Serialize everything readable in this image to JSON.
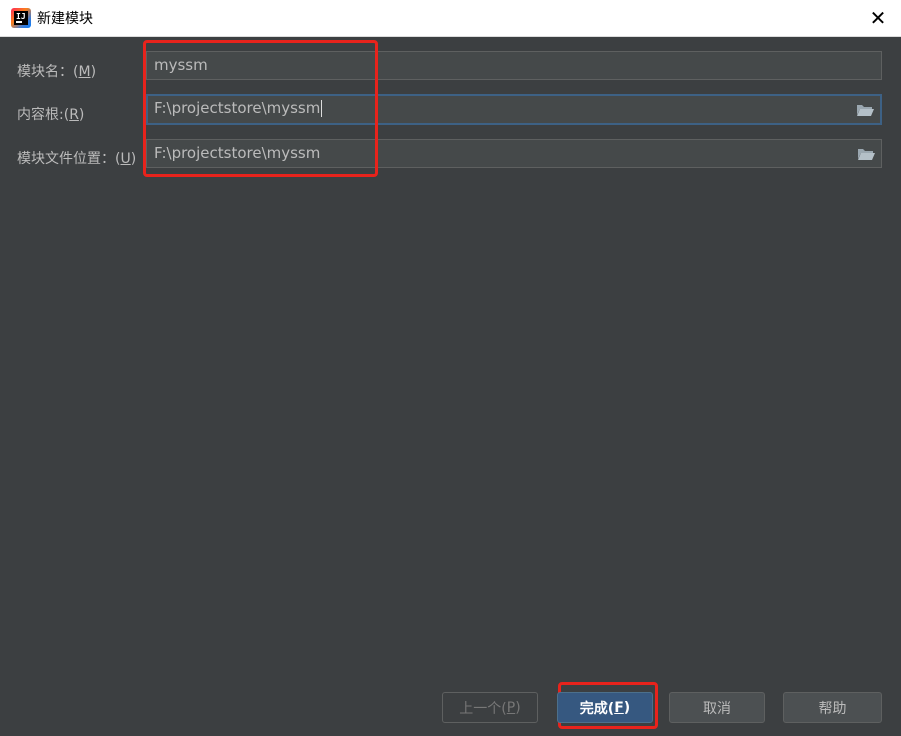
{
  "window": {
    "title": "新建模块",
    "close_glyph": "✕"
  },
  "form": {
    "module_name": {
      "label_prefix": "模块名：(",
      "mnemonic": "M",
      "label_suffix": ")",
      "value": "myssm"
    },
    "content_root": {
      "label_prefix": "内容根:(",
      "mnemonic": "R",
      "label_suffix": ")",
      "value": "F:\\projectstore\\myssm"
    },
    "module_file_location": {
      "label_prefix": "模块文件位置：(",
      "mnemonic": "U",
      "label_suffix": ")",
      "value": "F:\\projectstore\\myssm"
    }
  },
  "buttons": {
    "previous": {
      "label_prefix": "上一个(",
      "mnemonic": "P",
      "label_suffix": ")",
      "enabled": false
    },
    "finish": {
      "label_prefix": "完成(",
      "mnemonic": "F",
      "label_suffix": ")",
      "enabled": true
    },
    "cancel": {
      "label": "取消"
    },
    "help": {
      "label": "帮助"
    }
  },
  "icons": {
    "app": "intellij-idea-icon",
    "folder": "folder-open-icon",
    "close": "close-icon"
  },
  "colors": {
    "dialog_bg": "#3c3f41",
    "field_bg": "#45494a",
    "focus_border": "#3d6185",
    "primary_button": "#365880",
    "highlight": "#e8231c"
  }
}
